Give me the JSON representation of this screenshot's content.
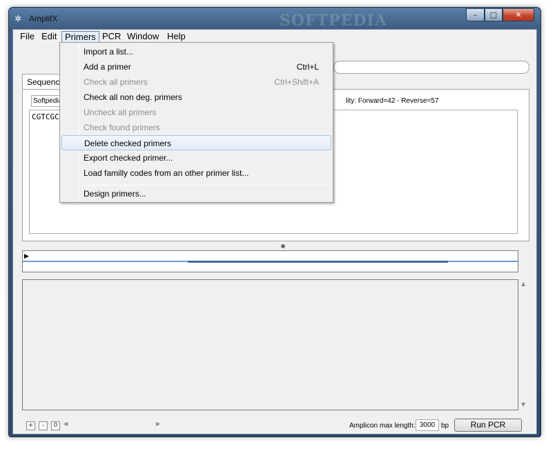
{
  "window": {
    "title": "AmplifX",
    "icon": "amplifx-logo-icon",
    "watermark": "SOFTPEDIA",
    "controls": {
      "minimize": "–",
      "maximize": "□",
      "close": "✕"
    }
  },
  "menubar": {
    "items": [
      {
        "label": "File"
      },
      {
        "label": "Edit"
      },
      {
        "label": "Primers",
        "open": true
      },
      {
        "label": "PCR"
      },
      {
        "label": "Window"
      },
      {
        "label": "Help"
      }
    ]
  },
  "primers_menu": {
    "items": [
      {
        "label": "Import a list...",
        "shortcut": "",
        "enabled": true
      },
      {
        "label": "Add a primer",
        "shortcut": "Ctrl+L",
        "enabled": true
      },
      {
        "label": "Check all primers",
        "shortcut": "Ctrl+Shift+A",
        "enabled": false
      },
      {
        "label": "Check all non deg. primers",
        "shortcut": "",
        "enabled": true
      },
      {
        "label": "Uncheck all primers",
        "shortcut": "",
        "enabled": false
      },
      {
        "label": "Check found primers",
        "shortcut": "",
        "enabled": false
      },
      {
        "label": "Delete checked primers",
        "shortcut": "",
        "enabled": true,
        "highlighted": true
      },
      {
        "label": "Export checked primer...",
        "shortcut": "",
        "enabled": true
      },
      {
        "label": "Load familly codes from an other primer list...",
        "shortcut": "",
        "enabled": true
      },
      {
        "label": "Design primers...",
        "shortcut": "",
        "enabled": true
      }
    ]
  },
  "sequence_panel": {
    "tab_label": "Sequence",
    "sequence_name": "Softpedia",
    "quality_text": "lity: Forward=42 - Reverse=57",
    "sequence_text": "CGTCGC"
  },
  "bottom": {
    "zoom_in": "+",
    "zoom_out": "-",
    "zoom_reset": "0",
    "amplicon_label": "Amplicon max length:",
    "amplicon_value": "3000",
    "amplicon_unit": "bp",
    "run_button": "Run PCR"
  },
  "colors": {
    "titlebar": "#3e5d82",
    "client_bg": "#f0f0f0",
    "track_line": "#6a9bd8",
    "track_highlight": "#3c6aa3",
    "menu_highlight": "#e3ecf7"
  }
}
